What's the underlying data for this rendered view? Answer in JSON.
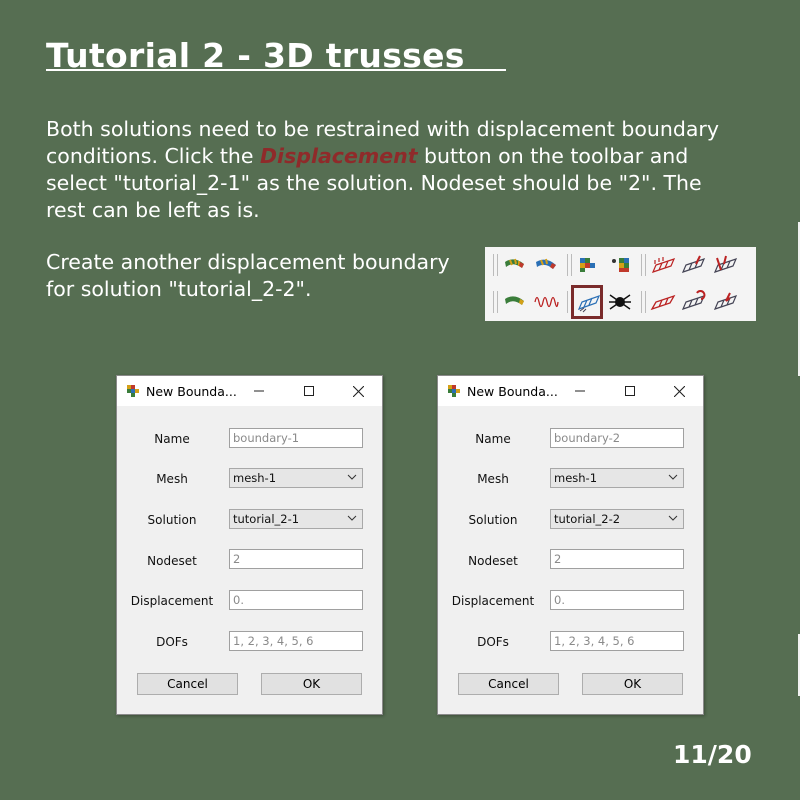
{
  "slide": {
    "title": "Tutorial 2 - 3D trusses",
    "para1_before": "Both solutions need to be restrained with displacement boundary conditions. Click the ",
    "para1_highlight": "Displacement",
    "para1_after": " button on the toolbar and select \"tutorial_2-1\" as the solution. Nodeset should be \"2\". The rest can be left as is.",
    "para2": "Create another displacement boundary for solution \"tutorial_2-2\".",
    "page_number": "11/20",
    "highlight_color": "#8f2a2a",
    "background_color": "#566e52"
  },
  "toolbar": {
    "row1_icons": [
      "beam-curve-icon",
      "beam-curve-2-icon",
      "grid-section-icon",
      "node-section-icon",
      "truss-mesh-icon",
      "truss-mesh-2-icon",
      "truss-mesh-3-icon"
    ],
    "row2_icons": [
      "curved-beam-icon",
      "spring-wave-icon",
      "displacement-icon",
      "spider-node-icon",
      "truss-load-icon",
      "truss-rotate-icon",
      "truss-arrow-icon"
    ],
    "highlighted_icon": "displacement-icon"
  },
  "dialogs": [
    {
      "title": "New Bounda...",
      "labels": {
        "name": "Name",
        "mesh": "Mesh",
        "solution": "Solution",
        "nodeset": "Nodeset",
        "displacement": "Displacement",
        "dofs": "DOFs"
      },
      "values": {
        "name": "boundary-1",
        "mesh": "mesh-1",
        "solution": "tutorial_2-1",
        "nodeset": "2",
        "displacement": "0.",
        "dofs": "1, 2, 3, 4, 5, 6"
      },
      "buttons": {
        "cancel": "Cancel",
        "ok": "OK"
      }
    },
    {
      "title": "New Bounda...",
      "labels": {
        "name": "Name",
        "mesh": "Mesh",
        "solution": "Solution",
        "nodeset": "Nodeset",
        "displacement": "Displacement",
        "dofs": "DOFs"
      },
      "values": {
        "name": "boundary-2",
        "mesh": "mesh-1",
        "solution": "tutorial_2-2",
        "nodeset": "2",
        "displacement": "0.",
        "dofs": "1, 2, 3, 4, 5, 6"
      },
      "buttons": {
        "cancel": "Cancel",
        "ok": "OK"
      }
    }
  ]
}
